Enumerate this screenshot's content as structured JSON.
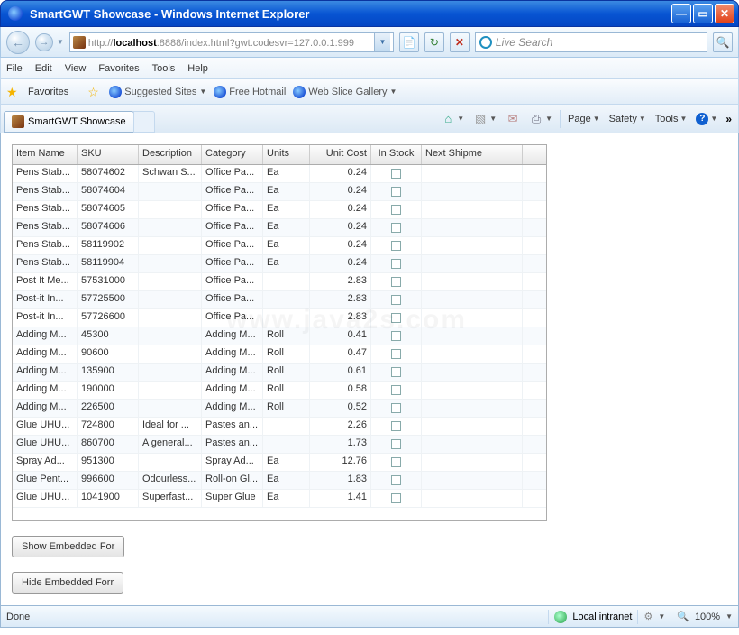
{
  "window": {
    "title": "SmartGWT Showcase - Windows Internet Explorer",
    "url_prefix": "http://",
    "url_host": "localhost",
    "url_rest": ":8888/index.html?gwt.codesvr=127.0.0.1:999",
    "search_placeholder": "Live Search"
  },
  "menus": {
    "file": "File",
    "edit": "Edit",
    "view": "View",
    "favorites": "Favorites",
    "tools": "Tools",
    "help": "Help"
  },
  "fav": {
    "favorites": "Favorites",
    "suggested": "Suggested Sites",
    "hotmail": "Free Hotmail",
    "slice": "Web Slice Gallery"
  },
  "tab": {
    "title": "SmartGWT Showcase"
  },
  "cmd": {
    "page": "Page",
    "safety": "Safety",
    "tools": "Tools"
  },
  "grid": {
    "headers": {
      "name": "Item Name",
      "sku": "SKU",
      "desc": "Description",
      "cat": "Category",
      "units": "Units",
      "cost": "Unit Cost",
      "stock": "In Stock",
      "ship": "Next Shipme"
    },
    "rows": [
      {
        "name": "Pens Stab...",
        "sku": "58074602",
        "desc": "Schwan S...",
        "cat": "Office Pa...",
        "units": "Ea",
        "cost": "0.24"
      },
      {
        "name": "Pens Stab...",
        "sku": "58074604",
        "desc": "",
        "cat": "Office Pa...",
        "units": "Ea",
        "cost": "0.24"
      },
      {
        "name": "Pens Stab...",
        "sku": "58074605",
        "desc": "",
        "cat": "Office Pa...",
        "units": "Ea",
        "cost": "0.24"
      },
      {
        "name": "Pens Stab...",
        "sku": "58074606",
        "desc": "",
        "cat": "Office Pa...",
        "units": "Ea",
        "cost": "0.24"
      },
      {
        "name": "Pens Stab...",
        "sku": "58119902",
        "desc": "",
        "cat": "Office Pa...",
        "units": "Ea",
        "cost": "0.24"
      },
      {
        "name": "Pens Stab...",
        "sku": "58119904",
        "desc": "",
        "cat": "Office Pa...",
        "units": "Ea",
        "cost": "0.24"
      },
      {
        "name": "Post It Me...",
        "sku": "57531000",
        "desc": "",
        "cat": "Office Pa...",
        "units": "",
        "cost": "2.83"
      },
      {
        "name": "Post-it In...",
        "sku": "57725500",
        "desc": "",
        "cat": "Office Pa...",
        "units": "",
        "cost": "2.83"
      },
      {
        "name": "Post-it In...",
        "sku": "57726600",
        "desc": "",
        "cat": "Office Pa...",
        "units": "",
        "cost": "2.83"
      },
      {
        "name": "Adding M...",
        "sku": "45300",
        "desc": "",
        "cat": "Adding M...",
        "units": "Roll",
        "cost": "0.41"
      },
      {
        "name": "Adding M...",
        "sku": "90600",
        "desc": "",
        "cat": "Adding M...",
        "units": "Roll",
        "cost": "0.47"
      },
      {
        "name": "Adding M...",
        "sku": "135900",
        "desc": "",
        "cat": "Adding M...",
        "units": "Roll",
        "cost": "0.61"
      },
      {
        "name": "Adding M...",
        "sku": "190000",
        "desc": "",
        "cat": "Adding M...",
        "units": "Roll",
        "cost": "0.58"
      },
      {
        "name": "Adding M...",
        "sku": "226500",
        "desc": "",
        "cat": "Adding M...",
        "units": "Roll",
        "cost": "0.52"
      },
      {
        "name": "Glue UHU...",
        "sku": "724800",
        "desc": "Ideal for ...",
        "cat": "Pastes an...",
        "units": "",
        "cost": "2.26"
      },
      {
        "name": "Glue UHU...",
        "sku": "860700",
        "desc": "A general...",
        "cat": "Pastes an...",
        "units": "",
        "cost": "1.73"
      },
      {
        "name": "Spray Ad...",
        "sku": "951300",
        "desc": "",
        "cat": "Spray Ad...",
        "units": "Ea",
        "cost": "12.76"
      },
      {
        "name": "Glue Pent...",
        "sku": "996600",
        "desc": "Odourless...",
        "cat": "Roll-on Gl...",
        "units": "Ea",
        "cost": "1.83"
      },
      {
        "name": "Glue UHU...",
        "sku": "1041900",
        "desc": "Superfast...",
        "cat": "Super Glue",
        "units": "Ea",
        "cost": "1.41"
      }
    ]
  },
  "buttons": {
    "show": "Show Embedded For",
    "hide": "Hide Embedded Forr"
  },
  "status": {
    "done": "Done",
    "zone": "Local intranet",
    "zoom": "100%"
  },
  "watermark": "www.java2s.com"
}
